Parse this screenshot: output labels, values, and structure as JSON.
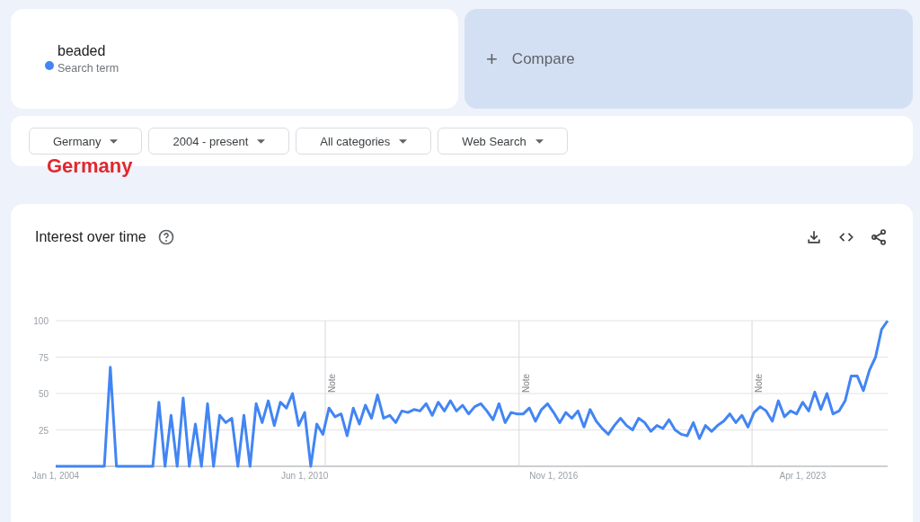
{
  "search_term": {
    "subtitle": "Search term"
  },
  "compare": {
    "icon": "+",
    "label": "Compare"
  },
  "filters": [
    {
      "label": "Germany"
    },
    {
      "label": "2004 - present"
    },
    {
      "label": "All categories"
    },
    {
      "label": "Web Search"
    }
  ],
  "annotation": "Germany",
  "interest_over_time": {
    "title": "Interest over time",
    "chart_data": {
      "type": "line",
      "ylim": [
        0,
        100
      ],
      "yticks": [
        100,
        75,
        50,
        25
      ],
      "grid": true,
      "annotations": [
        "Note",
        "Note",
        "Note"
      ],
      "categories": [
        "Jan 1, 2004",
        null,
        null,
        null,
        null,
        null,
        null,
        null,
        null,
        null,
        null,
        null,
        null,
        null,
        null,
        null,
        null,
        null,
        null,
        null,
        null,
        null,
        null,
        null,
        null,
        null,
        null,
        null,
        null,
        null,
        null,
        null,
        null,
        null,
        null,
        null,
        null,
        null,
        null,
        null,
        null,
        "Jun 1, 2010",
        null,
        null,
        null,
        null,
        null,
        null,
        null,
        null,
        null,
        null,
        null,
        null,
        null,
        null,
        null,
        null,
        null,
        null,
        null,
        null,
        null,
        null,
        null,
        null,
        null,
        null,
        null,
        null,
        null,
        null,
        null,
        null,
        null,
        null,
        null,
        null,
        null,
        null,
        null,
        null,
        "Nov 1, 2016",
        null,
        null,
        null,
        null,
        null,
        null,
        null,
        null,
        null,
        null,
        null,
        null,
        null,
        null,
        null,
        null,
        null,
        null,
        null,
        null,
        null,
        null,
        null,
        null,
        null,
        null,
        null,
        null,
        null,
        null,
        null,
        null,
        null,
        null,
        null,
        null,
        null,
        null,
        null,
        null,
        "Apr 1, 2023",
        null,
        null,
        null,
        null,
        null,
        null,
        null,
        null,
        null,
        null,
        null,
        null,
        null,
        null
      ],
      "series": [
        {
          "name": "beaded",
          "color": "#4285f4",
          "values": [
            0,
            0,
            0,
            0,
            0,
            0,
            0,
            0,
            0,
            68,
            0,
            0,
            0,
            0,
            0,
            0,
            0,
            44,
            0,
            35,
            0,
            47,
            0,
            29,
            0,
            43,
            0,
            35,
            30,
            33,
            0,
            35,
            0,
            43,
            30,
            45,
            28,
            44,
            40,
            50,
            28,
            37,
            0,
            29,
            22,
            40,
            34,
            36,
            21,
            40,
            29,
            42,
            33,
            49,
            33,
            35,
            30,
            38,
            37,
            39,
            38,
            43,
            35,
            44,
            38,
            45,
            38,
            42,
            36,
            41,
            43,
            38,
            32,
            43,
            30,
            37,
            36,
            36,
            40,
            31,
            39,
            43,
            37,
            30,
            37,
            33,
            38,
            27,
            39,
            31,
            26,
            22,
            28,
            33,
            28,
            25,
            33,
            30,
            24,
            28,
            26,
            32,
            25,
            22,
            21,
            30,
            19,
            28,
            24,
            28,
            31,
            36,
            30,
            35,
            27,
            37,
            41,
            38,
            31,
            45,
            34,
            38,
            36,
            44,
            38,
            51,
            39,
            50,
            36,
            38,
            45,
            62,
            62,
            52,
            66,
            75,
            94,
            100
          ]
        }
      ]
    }
  }
}
